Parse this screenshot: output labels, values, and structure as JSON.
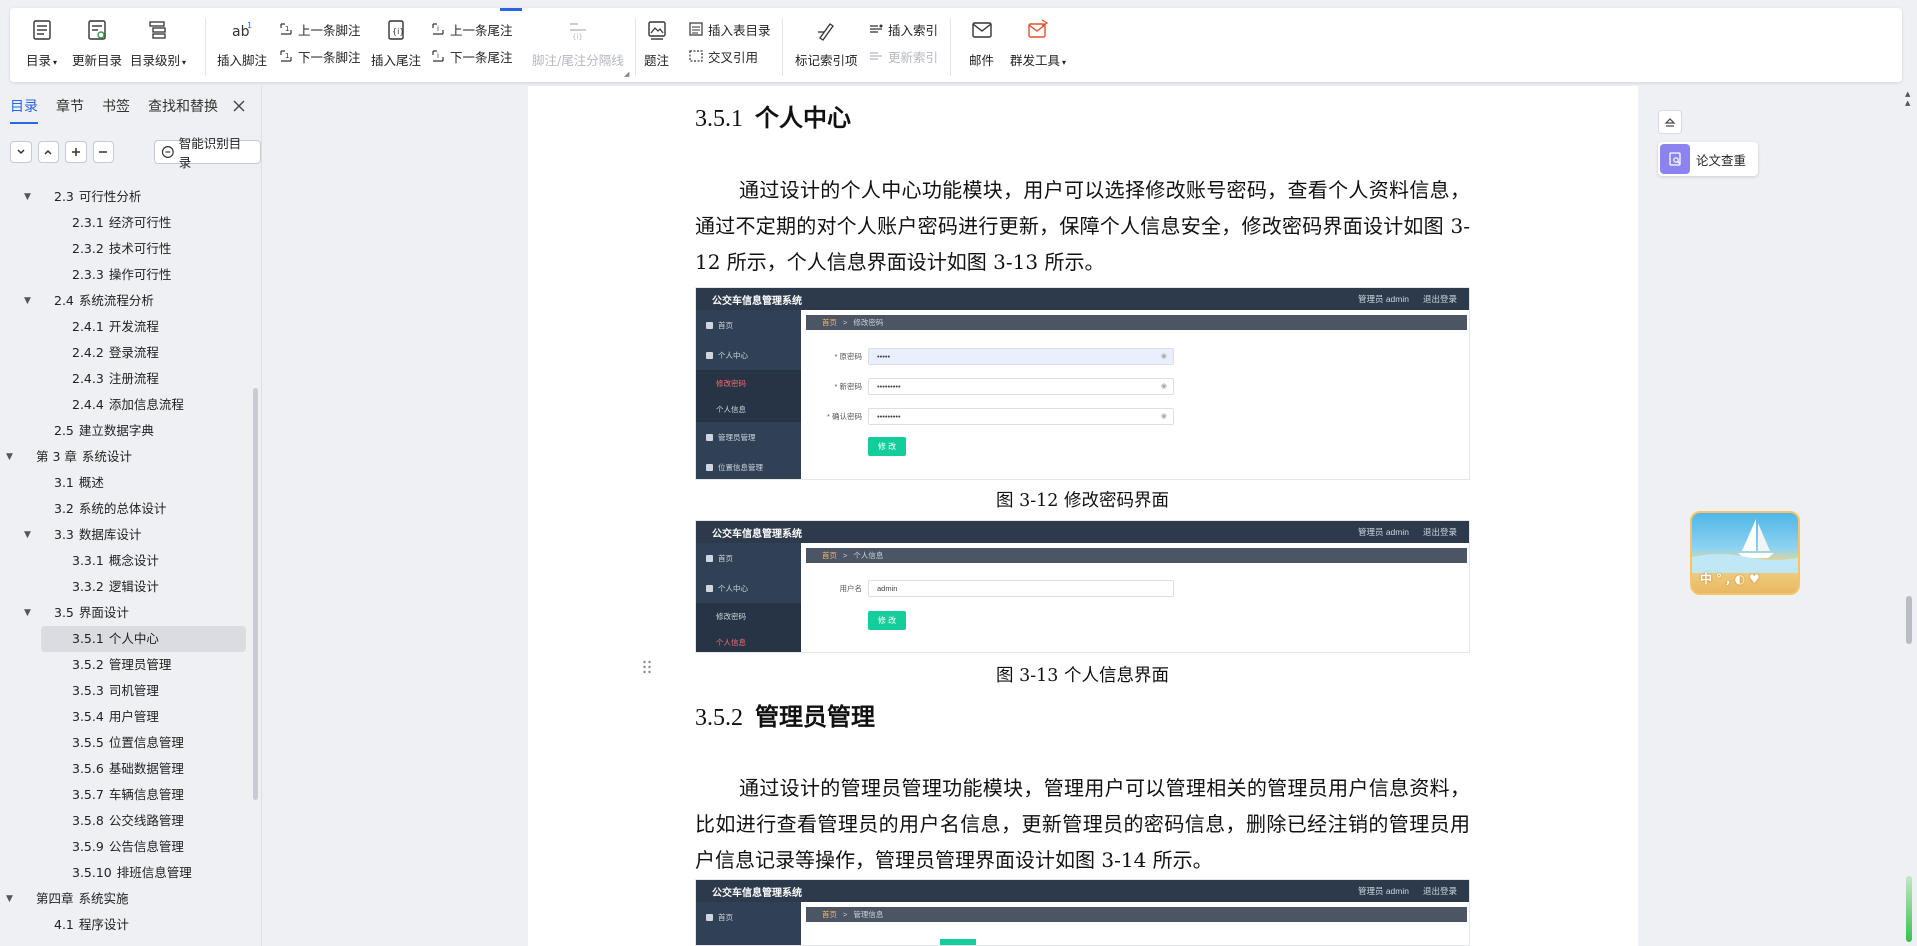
{
  "ribbon": {
    "toc": {
      "label": "目录"
    },
    "update_toc": {
      "label": "更新目录"
    },
    "toc_level": {
      "label": "目录级别"
    },
    "insert_footnote": {
      "label": "插入脚注"
    },
    "prev_footnote": {
      "label": "上一条脚注"
    },
    "next_footnote": {
      "label": "下一条脚注"
    },
    "insert_endnote": {
      "label": "插入尾注"
    },
    "prev_endnote": {
      "label": "上一条尾注"
    },
    "next_endnote": {
      "label": "下一条尾注"
    },
    "note_separator": {
      "label": "脚注/尾注分隔线"
    },
    "caption": {
      "label": "题注"
    },
    "insert_table_of_figures": {
      "label": "插入表目录"
    },
    "cross_reference": {
      "label": "交叉引用"
    },
    "mark_index_entry": {
      "label": "标记索引项"
    },
    "insert_index": {
      "label": "插入索引"
    },
    "update_index": {
      "label": "更新索引"
    },
    "mail": {
      "label": "邮件"
    },
    "mass_send_tools": {
      "label": "群发工具"
    }
  },
  "nav": {
    "tabs": [
      "目录",
      "章节",
      "书签",
      "查找和替换"
    ],
    "active_tab": "目录",
    "smart_toc_label": "智能识别目录",
    "toc": [
      {
        "num": "2.3",
        "text": "可行性分析",
        "level": 2,
        "expanded": true
      },
      {
        "num": "2.3.1",
        "text": "经济可行性",
        "level": 3
      },
      {
        "num": "2.3.2",
        "text": "技术可行性",
        "level": 3
      },
      {
        "num": "2.3.3",
        "text": "操作可行性",
        "level": 3
      },
      {
        "num": "2.4",
        "text": "系统流程分析",
        "level": 2,
        "expanded": true
      },
      {
        "num": "2.4.1",
        "text": "开发流程",
        "level": 3
      },
      {
        "num": "2.4.2",
        "text": "登录流程",
        "level": 3
      },
      {
        "num": "2.4.3",
        "text": "注册流程",
        "level": 3
      },
      {
        "num": "2.4.4",
        "text": "添加信息流程",
        "level": 3
      },
      {
        "num": "2.5",
        "text": "建立数据字典",
        "level": 2
      },
      {
        "num": "第 3 章",
        "text": "系统设计",
        "level": 1,
        "expanded": true
      },
      {
        "num": "3.1",
        "text": "概述",
        "level": 2
      },
      {
        "num": "3.2",
        "text": "系统的总体设计",
        "level": 2
      },
      {
        "num": "3.3",
        "text": "数据库设计",
        "level": 2,
        "expanded": true
      },
      {
        "num": "3.3.1",
        "text": "概念设计",
        "level": 3
      },
      {
        "num": "3.3.2",
        "text": "逻辑设计",
        "level": 3
      },
      {
        "num": "3.5",
        "text": "界面设计",
        "level": 2,
        "expanded": true
      },
      {
        "num": "3.5.1",
        "text": "个人中心",
        "level": 3,
        "selected": true
      },
      {
        "num": "3.5.2",
        "text": "管理员管理",
        "level": 3
      },
      {
        "num": "3.5.3",
        "text": "司机管理",
        "level": 3
      },
      {
        "num": "3.5.4",
        "text": "用户管理",
        "level": 3
      },
      {
        "num": "3.5.5",
        "text": "位置信息管理",
        "level": 3
      },
      {
        "num": "3.5.6",
        "text": "基础数据管理",
        "level": 3
      },
      {
        "num": "3.5.7",
        "text": "车辆信息管理",
        "level": 3
      },
      {
        "num": "3.5.8",
        "text": "公交线路管理",
        "level": 3
      },
      {
        "num": "3.5.9",
        "text": "公告信息管理",
        "level": 3
      },
      {
        "num": "3.5.10",
        "text": "排班信息管理",
        "level": 3
      },
      {
        "num": "第四章",
        "text": "系统实施",
        "level": 1,
        "expanded": true
      },
      {
        "num": "4.1",
        "text": "程序设计",
        "level": 2
      }
    ]
  },
  "doc": {
    "s351": {
      "num": "3.5.1",
      "title": "个人中心"
    },
    "para1": "通过设计的个人中心功能模块，用户可以选择修改账号密码，查看个人资料信息，通过不定期的对个人账户密码进行更新，保障个人信息安全，修改密码界面设计如图 3-12 所示，个人信息界面设计如图 3-13 所示。",
    "fig312": {
      "app_title": "公交车信息管理系统",
      "role": "管理员 admin",
      "logout": "退出登录",
      "crumb_home": "首页",
      "crumb_page": "修改密码",
      "menu": [
        "首页",
        "个人中心",
        "修改密码",
        "个人信息",
        "管理员管理",
        "位置信息管理"
      ],
      "fields": [
        {
          "label": "* 原密码",
          "value": "•••••"
        },
        {
          "label": "* 新密码",
          "value": "•••••••••"
        },
        {
          "label": "* 确认密码",
          "value": "•••••••••"
        }
      ],
      "button": "修 改",
      "caption": "图 3-12  修改密码界面"
    },
    "fig313": {
      "app_title": "公交车信息管理系统",
      "role": "管理员 admin",
      "logout": "退出登录",
      "crumb_home": "首页",
      "crumb_page": "个人信息",
      "menu": [
        "首页",
        "个人中心",
        "修改密码",
        "个人信息"
      ],
      "field_label": "用户名",
      "field_value": "admin",
      "button": "修 改",
      "caption": "图 3-13  个人信息界面"
    },
    "s352": {
      "num": "3.5.2",
      "title": "管理员管理"
    },
    "para2": "通过设计的管理员管理功能模块，管理用户可以管理相关的管理员用户信息资料，比如进行查看管理员的用户名信息，更新管理员的密码信息，删除已经注销的管理员用户信息记录等操作，管理员管理界面设计如图 3-14 所示。",
    "fig314": {
      "app_title": "公交车信息管理系统",
      "role": "管理员 admin",
      "logout": "退出登录",
      "crumb_home": "首页",
      "crumb_page": "管理信息",
      "menu": [
        "首页"
      ]
    }
  },
  "right": {
    "plagiarism_label": "论文查重",
    "ime_glyph": "中"
  },
  "colors": {
    "accent": "#2a64e8",
    "sys_header": "#2d3a4b",
    "sys_sidebar": "#304156",
    "sys_button": "#13ce9a",
    "sys_active_menu": "#f56c6c",
    "plagiarism_badge": "#8a83f0"
  }
}
